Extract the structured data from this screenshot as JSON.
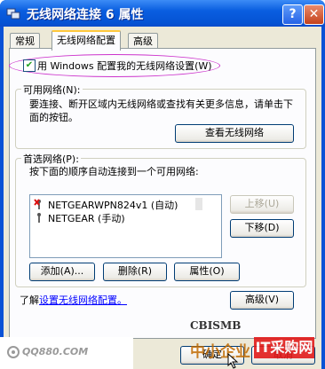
{
  "window": {
    "title": "无线网络连接 6 属性",
    "help_label": "?",
    "close_label": "✕"
  },
  "tabs": [
    {
      "label": "常规"
    },
    {
      "label": "无线网络配置"
    },
    {
      "label": "高级"
    }
  ],
  "use_windows_checkbox": {
    "label": "用 Windows 配置我的无线网络设置(W)",
    "checked": true,
    "mark": "✔"
  },
  "available_networks": {
    "title": "可用网络(N):",
    "description": "要连接、断开区域内无线网络或查找有关更多信息，请单击下面的按钮。",
    "view_button": "查看无线网络"
  },
  "preferred_networks": {
    "title": "首选网络(P):",
    "description": "按下面的顺序自动连接到一个可用网络:",
    "items": [
      {
        "label": "NETGEARWPN824v1 (自动)",
        "icon": "wireless-network-x-icon"
      },
      {
        "label": "NETGEAR (手动)",
        "icon": "wireless-network-icon"
      }
    ],
    "move_up": "上移(U)",
    "move_down": "下移(D)",
    "add": "添加(A)...",
    "remove": "删除(R)",
    "properties": "属性(O)"
  },
  "learn_more": {
    "prefix": "了解",
    "link": "设置无线网络配置。"
  },
  "advanced_button": "高级(V)",
  "ok_button": "确定",
  "cancel_button": "取消",
  "watermarks": {
    "cbi": "CBISMB",
    "qq": "QQ880.COM",
    "zhongxiao": "中小企业",
    "it": "IT采购网"
  },
  "colors": {
    "titlebar": "#0a5ee0",
    "client_bg": "#ece9d8",
    "highlight_ellipse": "#cc33cc",
    "link": "#0000ff"
  }
}
